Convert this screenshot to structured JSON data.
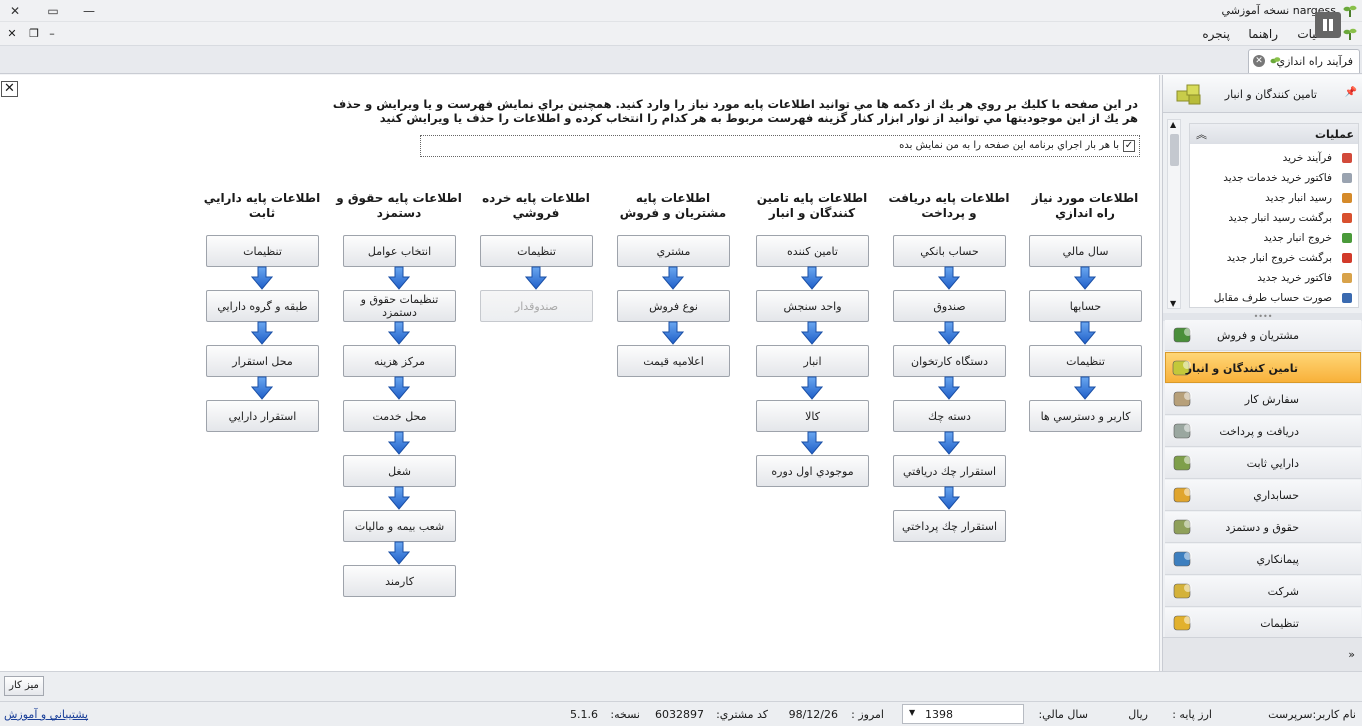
{
  "window": {
    "title": "nargess نسخه آموزشي"
  },
  "menubar": {
    "items": [
      "عمليات",
      "راهنما",
      "پنجره"
    ]
  },
  "tab": {
    "label": "فرآيند راه اندازي"
  },
  "main": {
    "intro_line1": "در اين صفحه با كليك بر روي هر يك از دكمه ها مي توانيد اطلاعات پايه مورد نياز را وارد كنيد. همچنين براي نمايش فهرست و يا ويرايش و حذف",
    "intro_line2": "هر يك از اين موجوديتها مي توانيد از نوار ابزار كنار گزينه فهرست مربوط به هر كدام را انتخاب كرده و اطلاعات را حذف يا ويرايش كنيد",
    "show_checkbox_label": "با هر بار اجراي برنامه اين صفحه را به من نمايش بده",
    "show_checkbox_checked": true,
    "columns": [
      {
        "title": "اطلاعات مورد نياز راه اندازي",
        "buttons": [
          "سال مالي",
          "حسابها",
          "تنظيمات",
          "كاربر و دسترسي ها"
        ]
      },
      {
        "title": "اطلاعات پايه دريافت و پرداخت",
        "buttons": [
          "حساب بانكي",
          "صندوق",
          "دستگاه كارتخوان",
          "دسته چك",
          "استقرار چك دريافتي",
          "استقرار چك پرداختي"
        ]
      },
      {
        "title": "اطلاعات پايه تامين كنندگان و انبار",
        "buttons": [
          "تامين كننده",
          "واحد سنجش",
          "انبار",
          "كالا",
          "موجودي اول دوره"
        ]
      },
      {
        "title": "اطلاعات پايه مشتريان و فروش",
        "buttons": [
          "مشتري",
          "نوع فروش",
          "اعلاميه قيمت"
        ]
      },
      {
        "title": "اطلاعات پايه خرده فروشي",
        "buttons": [
          "تنظيمات",
          "صندوقدار"
        ]
      },
      {
        "title": "اطلاعات پايه حقوق و دستمزد",
        "buttons": [
          "انتخاب عوامل",
          "تنظيمات حقوق و دستمزد",
          "مركز هزينه",
          "محل خدمت",
          "شغل",
          "شعب بيمه و ماليات",
          "كارمند"
        ]
      },
      {
        "title": "اطلاعات پايه دارايي ثابت",
        "buttons": [
          "تنظيمات",
          "طبقه و گروه دارايي",
          "محل استقرار",
          "استقرار دارايي"
        ]
      }
    ]
  },
  "sidebar": {
    "header": "تامين كنندگان و انبار",
    "ops_title": "عمليات",
    "ops": [
      {
        "label": "فرآيند خريد",
        "icon": "process-icon"
      },
      {
        "label": "فاكتور خريد خدمات جديد",
        "icon": "invoice-icon"
      },
      {
        "label": "رسيد انبار جديد",
        "icon": "receipt-icon"
      },
      {
        "label": "برگشت رسيد انبار جديد",
        "icon": "return-receipt-icon"
      },
      {
        "label": "خروج انبار جديد",
        "icon": "exit-icon"
      },
      {
        "label": "برگشت خروج انبار جديد",
        "icon": "return-exit-icon"
      },
      {
        "label": "فاكتور خريد جديد",
        "icon": "purchase-invoice-icon"
      },
      {
        "label": "صورت حساب طرف مقابل",
        "icon": "statement-icon"
      }
    ],
    "nav": [
      {
        "label": "مشتريان و فروش",
        "icon": "sales-chart-icon",
        "color": "#4a8f3a"
      },
      {
        "label": "تامين كنندگان و انبار",
        "icon": "boxes-icon",
        "color": "#c3c83a"
      },
      {
        "label": "سفارش كار",
        "icon": "work-order-icon",
        "color": "#b7a07a"
      },
      {
        "label": "دريافت و پرداخت",
        "icon": "payment-icon",
        "color": "#9aa7a0"
      },
      {
        "label": "دارايي ثابت",
        "icon": "assets-icon",
        "color": "#7e9f4a"
      },
      {
        "label": "حسابداري",
        "icon": "accounting-icon",
        "color": "#e0a52e"
      },
      {
        "label": "حقوق و دستمزد",
        "icon": "salary-icon",
        "color": "#8fa05a"
      },
      {
        "label": "پيمانكاري",
        "icon": "globe-icon",
        "color": "#3d7fbf"
      },
      {
        "label": "شركت",
        "icon": "company-icon",
        "color": "#d4b23a"
      },
      {
        "label": "تنظيمات",
        "icon": "settings-icon",
        "color": "#e2b12d"
      }
    ],
    "active_nav": 1
  },
  "taskbar": {
    "desk_label": "ميز كار"
  },
  "status": {
    "user_label": "نام كاربر:سرپرست",
    "currency_label": "ارز پايه :",
    "currency_value": "ريال",
    "year_label": "سال مالي:",
    "year_value": "1398",
    "today_label": "امروز :",
    "today_value": "98/12/26",
    "customer_code_label": "كد مشتري:",
    "customer_code_value": "6032897",
    "version_label": "نسخه:",
    "version_value": "5.1.6",
    "support_label": "پشتيباني و آموزش"
  }
}
